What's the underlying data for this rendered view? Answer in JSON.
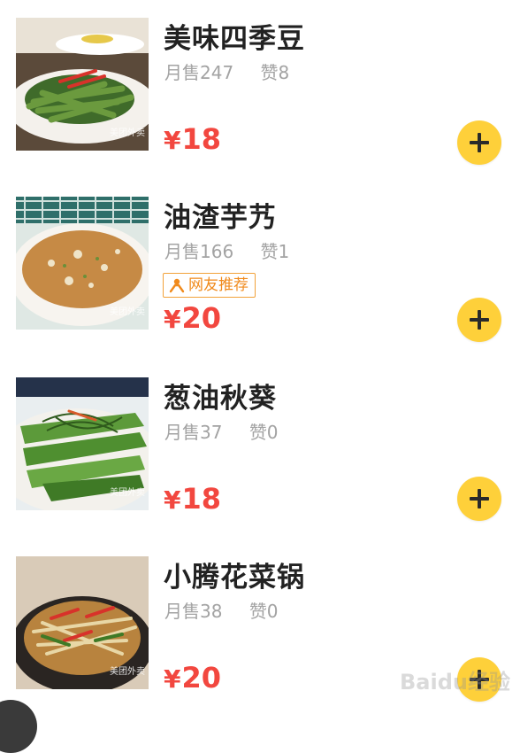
{
  "items": [
    {
      "name": "美味四季豆",
      "sales": "月售247",
      "likes": "赞8",
      "price_symbol": "¥",
      "price": "18",
      "tag": "",
      "watermark": "美团外卖"
    },
    {
      "name": "油渣芋艿",
      "sales": "月售166",
      "likes": "赞1",
      "price_symbol": "¥",
      "price": "20",
      "tag": "网友推荐",
      "watermark": "美团外卖"
    },
    {
      "name": "葱油秋葵",
      "sales": "月售37",
      "likes": "赞0",
      "price_symbol": "¥",
      "price": "18",
      "tag": "",
      "watermark": "美团外卖"
    },
    {
      "name": "小腾花菜锅",
      "sales": "月售38",
      "likes": "赞0",
      "price_symbol": "¥",
      "price": "20",
      "tag": "",
      "watermark": "美团外卖"
    }
  ],
  "watermark_text": "Baidu经验",
  "colors": {
    "price": "#f2473f",
    "add_button": "#fed03a",
    "tag": "#f08a1c",
    "stats": "#a3a3a3"
  },
  "icons": {
    "add": "plus-icon",
    "tag": "person-icon"
  }
}
